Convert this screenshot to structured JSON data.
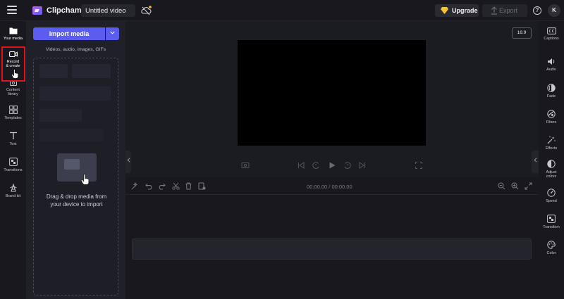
{
  "topbar": {
    "app_name": "Clipchamp",
    "video_title": "Untitled video",
    "upgrade_label": "Upgrade",
    "export_label": "Export",
    "help_label": "?",
    "avatar_initial": "K"
  },
  "leftnav": {
    "items": [
      {
        "label": "Your media",
        "icon": "folder-icon"
      },
      {
        "label": "Record & create",
        "icon": "video-camera-icon"
      },
      {
        "label": "Content library",
        "icon": "content-library-icon"
      },
      {
        "label": "Templates",
        "icon": "templates-icon"
      },
      {
        "label": "Text",
        "icon": "text-icon"
      },
      {
        "label": "Transitions",
        "icon": "transitions-icon"
      },
      {
        "label": "Brand kit",
        "icon": "brand-kit-icon"
      }
    ]
  },
  "media": {
    "import_label": "Import media",
    "hint": "Videos, audio, images, GIFs",
    "drop_line1": "Drag & drop media from",
    "drop_line2": "your device to import"
  },
  "preview": {
    "aspect_ratio": "16:9"
  },
  "timeline": {
    "time_display": "00:00.00 / 00:00.00"
  },
  "rightpanel": {
    "items": [
      {
        "label": "Captions",
        "icon": "captions-icon"
      },
      {
        "label": "Audio",
        "icon": "speaker-icon"
      },
      {
        "label": "Fade",
        "icon": "fade-icon"
      },
      {
        "label": "Filters",
        "icon": "filters-icon"
      },
      {
        "label": "Effects",
        "icon": "magic-wand-icon"
      },
      {
        "label": "Adjust colors",
        "icon": "adjust-colors-icon"
      },
      {
        "label": "Speed",
        "icon": "speedometer-icon"
      },
      {
        "label": "Transition",
        "icon": "transition-icon"
      },
      {
        "label": "Color",
        "icon": "palette-icon"
      }
    ]
  },
  "colors": {
    "accent": "#5b5cf0",
    "highlight": "#e0141e",
    "background": "#1b1b22"
  }
}
